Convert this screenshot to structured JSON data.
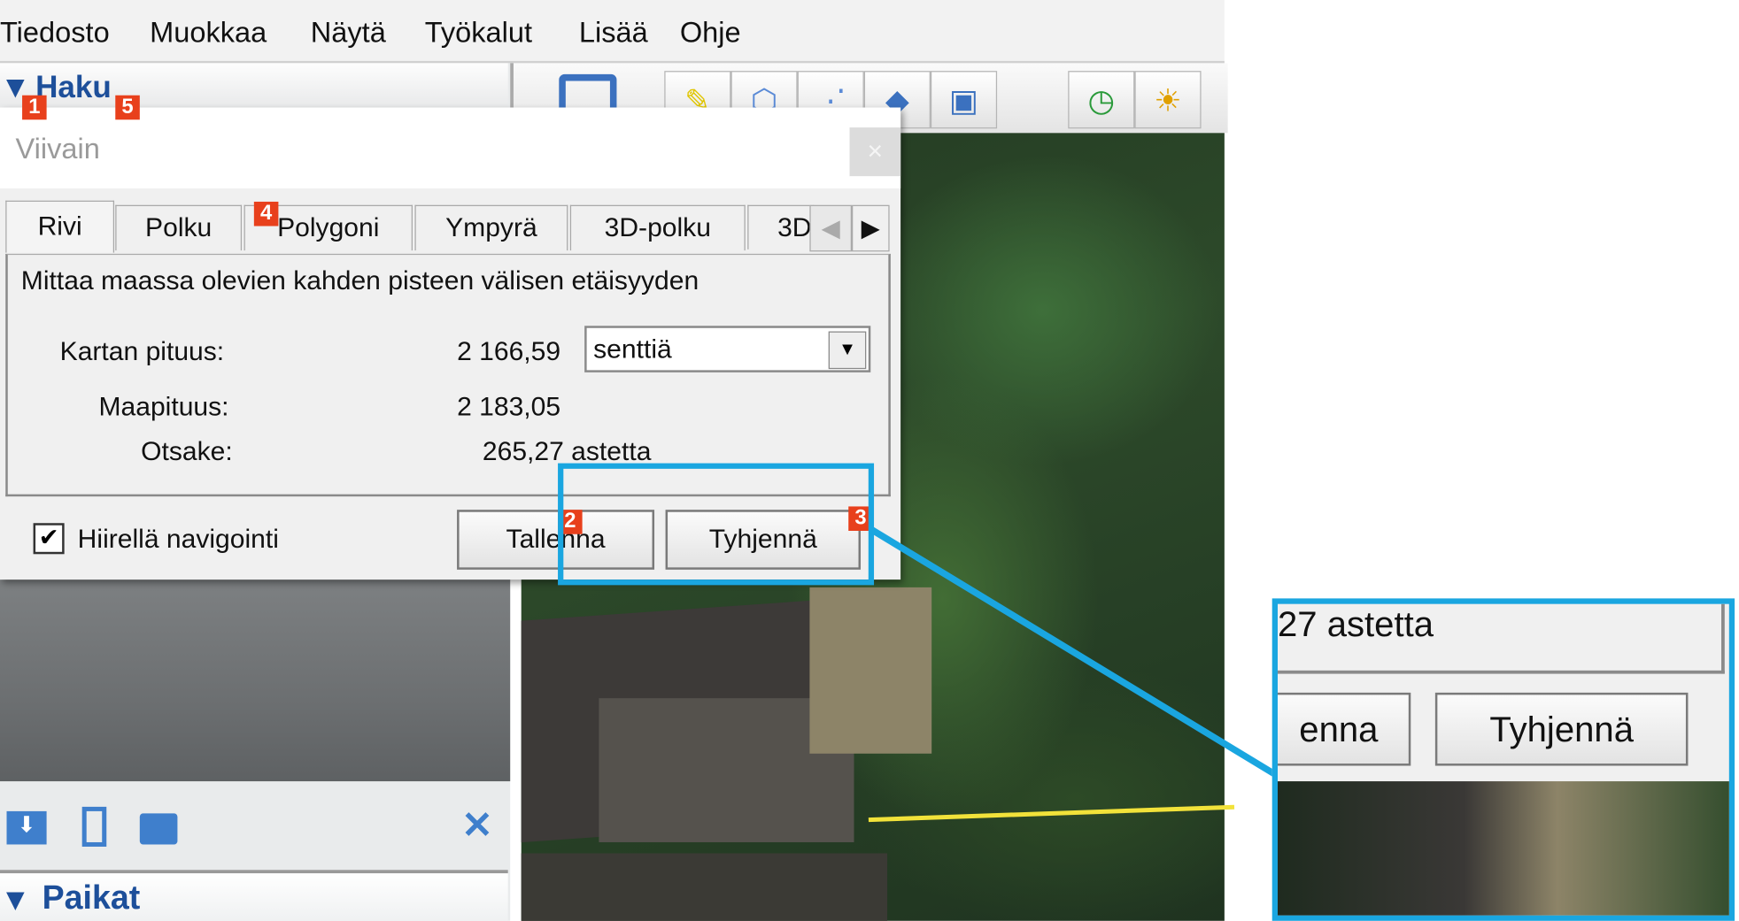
{
  "menu": [
    "Tiedosto",
    "Muokkaa",
    "Näytä",
    "Työkalut",
    "Lisää",
    "Ohje"
  ],
  "sidebar": {
    "search_header": "Haku",
    "places_header": "Paikat"
  },
  "dialog": {
    "title": "Viivain",
    "close": "×",
    "tabs": [
      "Rivi",
      "Polku",
      "Polygoni",
      "Ympyrä",
      "3D-polku",
      "3D"
    ],
    "description": "Mittaa maassa olevien kahden pisteen välisen etäisyyden",
    "map_length_label": "Kartan pituus:",
    "map_length_value": "2 166,59",
    "unit": "senttiä",
    "ground_length_label": "Maapituus:",
    "ground_length_value": "2 183,05",
    "heading_label": "Otsake:",
    "heading_value": "265,27 astetta",
    "mouse_nav_label": "Hiirellä navigointi",
    "mouse_nav_checked": true,
    "save_label": "Tallenna",
    "clear_label": "Tyhjennä"
  },
  "badges": [
    "1",
    "2",
    "3",
    "4",
    "5"
  ],
  "callout": {
    "heading_fragment": "27 astetta",
    "save_fragment": "enna",
    "clear_label": "Tyhjennä"
  },
  "colors": {
    "accent": "#1aa6e0",
    "badge": "#e8401c",
    "header": "#1d4f9a"
  }
}
